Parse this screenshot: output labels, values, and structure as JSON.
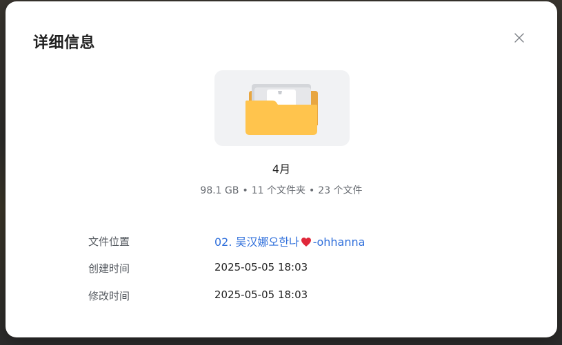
{
  "dialog": {
    "title": "详细信息"
  },
  "folder": {
    "name": "4月",
    "size": "98.1 GB",
    "folder_count": "11 个文件夹",
    "file_count": "23 个文件",
    "separator": "•"
  },
  "details": {
    "location_label": "文件位置",
    "location_value_prefix": "02. 吴汉娜오한나",
    "location_value_suffix": "-ohhanna",
    "created_label": "创建时间",
    "created_value": "2025-05-05 18:03",
    "modified_label": "修改时间",
    "modified_value": "2025-05-05 18:03"
  },
  "icons": {
    "close": "close-icon",
    "folder": "folder-icon",
    "heart": "heart-icon"
  },
  "colors": {
    "link": "#2f6fdb",
    "folder_yellow": "#ffc44d",
    "folder_back": "#e8a640",
    "preview_bg": "#f1f2f4",
    "heart": "#e0283a"
  }
}
